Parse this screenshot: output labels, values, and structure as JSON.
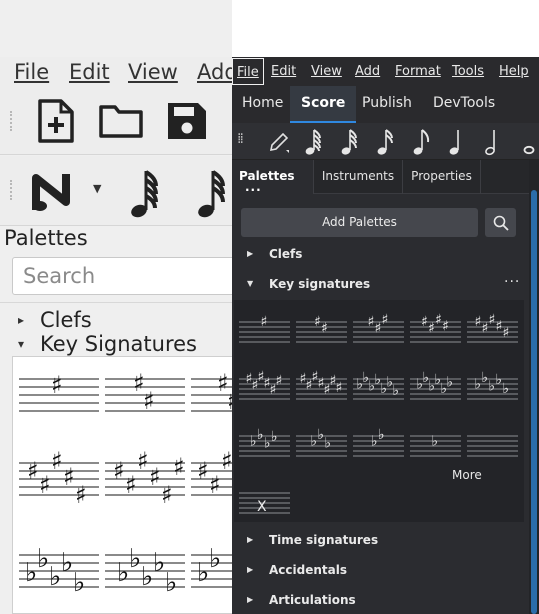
{
  "left_window": {
    "menu": [
      "File",
      "Edit",
      "View",
      "Add"
    ],
    "palettes_title": "Palettes",
    "search_placeholder": "Search",
    "tree": [
      {
        "label": "Clefs",
        "expanded": false
      },
      {
        "label": "Key Signatures",
        "expanded": true
      }
    ]
  },
  "right_window": {
    "menu": [
      "File",
      "Edit",
      "View",
      "Add",
      "Format",
      "Tools",
      "Help"
    ],
    "active_menu": "File",
    "tabs": [
      "Home",
      "Score",
      "Publish",
      "DevTools"
    ],
    "selected_tab": "Score",
    "panel_tabs": [
      "Palettes",
      "Instruments",
      "Properties"
    ],
    "selected_panel_tab": "Palettes",
    "panel_menu_glyph": "···",
    "add_palettes_label": "Add Palettes",
    "palettes": [
      {
        "label": "Clefs",
        "expanded": false
      },
      {
        "label": "Key signatures",
        "expanded": true
      },
      {
        "label": "Time signatures",
        "expanded": false
      },
      {
        "label": "Accidentals",
        "expanded": false
      },
      {
        "label": "Articulations",
        "expanded": false
      }
    ],
    "more_label": "More",
    "key_signatures": [
      "1 sharp",
      "2 sharps",
      "3 sharps",
      "4 sharps",
      "5 sharps",
      "6 sharps",
      "7 sharps",
      "7 flats",
      "6 flats",
      "5 flats",
      "4 flats",
      "3 flats",
      "2 flats",
      "1 flat",
      "no key",
      "open/atonal"
    ],
    "accent_color": "#2f88e0"
  }
}
